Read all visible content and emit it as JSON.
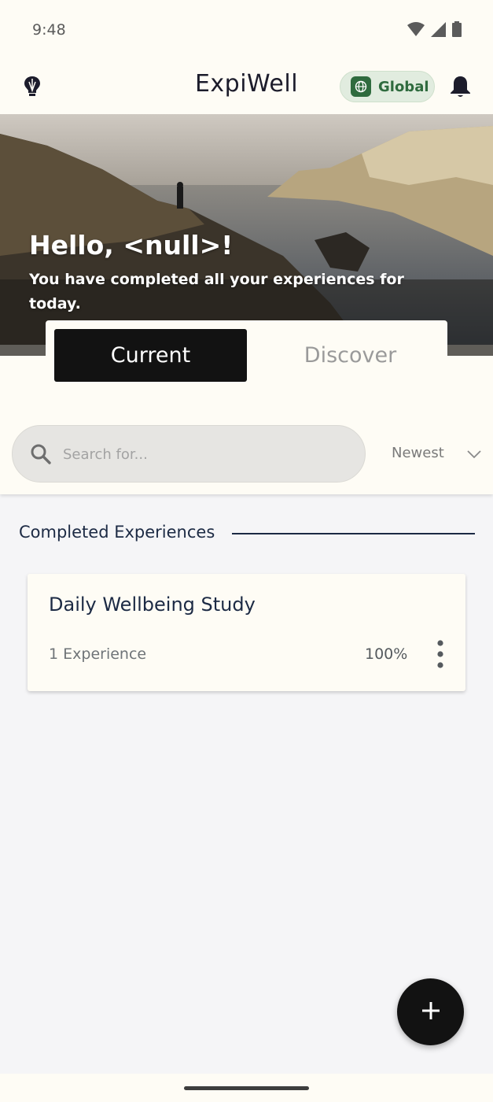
{
  "status_bar": {
    "time": "9:48",
    "icons": [
      "wifi-icon",
      "signal-icon",
      "battery-icon"
    ]
  },
  "app_bar": {
    "title": "ExpiWell",
    "left_icon": "lightbulb-icon",
    "global_label": "Global",
    "global_icon": "globe-icon",
    "right_icon": "bell-icon"
  },
  "hero": {
    "greeting": "Hello, <null>!",
    "subtitle": "You have completed all your experiences for today."
  },
  "tabs": [
    {
      "label": "Current",
      "active": true
    },
    {
      "label": "Discover",
      "active": false
    }
  ],
  "search": {
    "placeholder": "Search for...",
    "value": ""
  },
  "sort": {
    "selected": "Newest"
  },
  "section": {
    "title": "Completed Experiences"
  },
  "experiences": [
    {
      "title": "Daily Wellbeing Study",
      "count": "1 Experience",
      "progress": "100%"
    }
  ],
  "fab": {
    "icon": "plus-icon"
  },
  "colors": {
    "background": "#fefcf5",
    "accent_dark": "#121212",
    "global_green": "#2f6b3e",
    "navy_text": "#1c2a44"
  }
}
